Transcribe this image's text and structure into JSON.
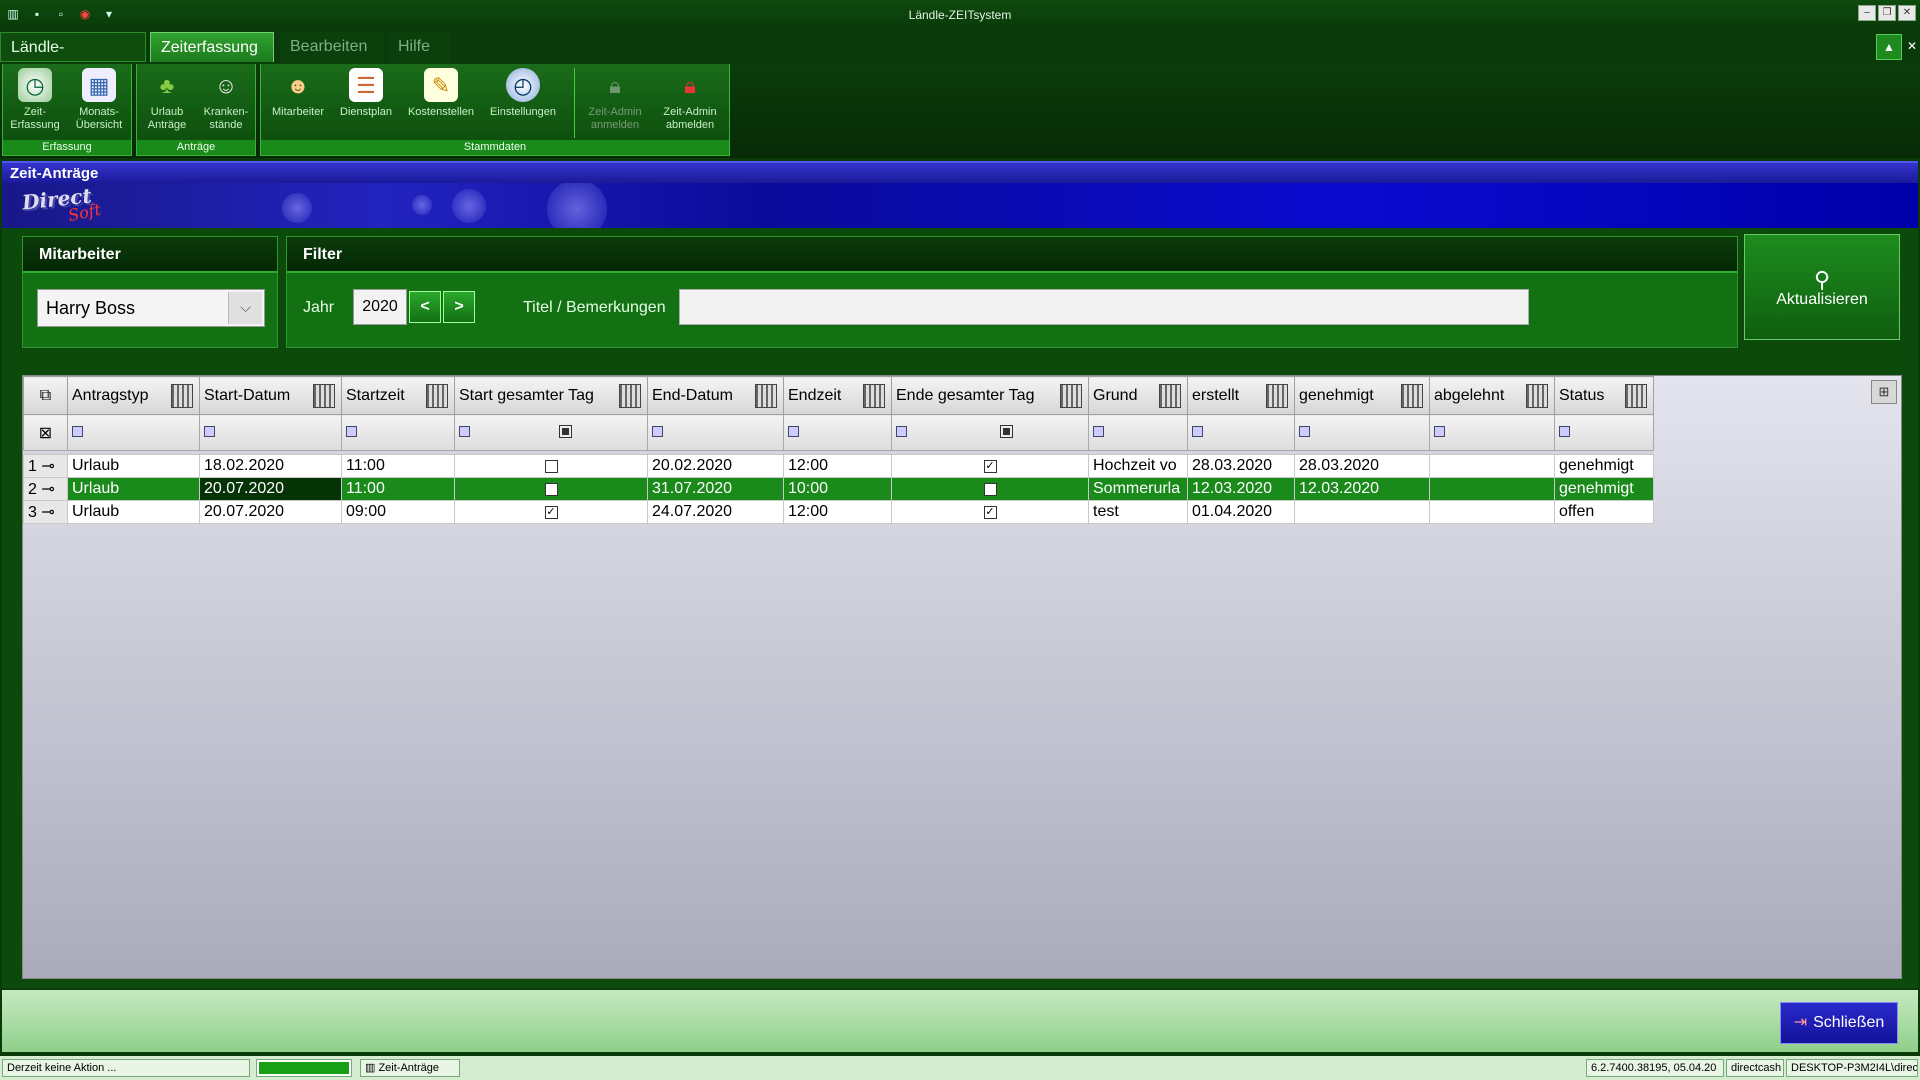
{
  "window": {
    "title": "Ländle-ZEITsystem"
  },
  "tabs": [
    {
      "label": "Ländle-ZEITsystem"
    },
    {
      "label": "Zeiterfassung"
    },
    {
      "label": "Bearbeiten"
    },
    {
      "label": "Hilfe"
    }
  ],
  "ribbon": {
    "groups": [
      {
        "label": "Erfassung",
        "items": [
          "Zeit-\nErfassung",
          "Monats-\nÜbersicht"
        ]
      },
      {
        "label": "Anträge",
        "items": [
          "Urlaub\nAnträge",
          "Kranken-\nstände"
        ]
      },
      {
        "label": "Stammdaten",
        "items": [
          "Mitarbeiter",
          "Dienstplan",
          "Kostenstellen",
          "Einstellungen",
          "Zeit-Admin\nanmelden",
          "Zeit-Admin\nabmelden"
        ]
      }
    ]
  },
  "form": {
    "title": "Zeit-Anträge",
    "logo_top": "Direct",
    "logo_bottom": "Soft"
  },
  "mitarbeiter": {
    "header": "Mitarbeiter",
    "selected": "Harry Boss"
  },
  "filter": {
    "header": "Filter",
    "jahr_label": "Jahr",
    "jahr_value": "2020",
    "prev": "<",
    "next": ">",
    "titel_label": "Titel / Bemerkungen",
    "titel_value": ""
  },
  "refresh": {
    "label": "Aktualisieren"
  },
  "grid": {
    "columns": [
      "Antragstyp",
      "Start-Datum",
      "Startzeit",
      "Start gesamter Tag",
      "End-Datum",
      "Endzeit",
      "Ende gesamter Tag",
      "Grund",
      "erstellt",
      "genehmigt",
      "abgelehnt",
      "Status"
    ],
    "rows": [
      {
        "nr": "1",
        "typ": "Urlaub",
        "start": "18.02.2020",
        "startzeit": "11:00",
        "start_ganz": false,
        "end": "20.02.2020",
        "endzeit": "12:00",
        "ende_ganz": true,
        "grund": "Hochzeit vo",
        "erstellt": "28.03.2020",
        "genehmigt": "28.03.2020",
        "abgelehnt": "",
        "status": "genehmigt"
      },
      {
        "nr": "2",
        "typ": "Urlaub",
        "start": "20.07.2020",
        "startzeit": "11:00",
        "start_ganz": false,
        "end": "31.07.2020",
        "endzeit": "10:00",
        "ende_ganz": false,
        "grund": "Sommerurla",
        "erstellt": "12.03.2020",
        "genehmigt": "12.03.2020",
        "abgelehnt": "",
        "status": "genehmigt"
      },
      {
        "nr": "3",
        "typ": "Urlaub",
        "start": "20.07.2020",
        "startzeit": "09:00",
        "start_ganz": true,
        "end": "24.07.2020",
        "endzeit": "12:00",
        "ende_ganz": true,
        "grund": "test",
        "erstellt": "01.04.2020",
        "genehmigt": "",
        "abgelehnt": "",
        "status": "offen"
      }
    ]
  },
  "close": {
    "label": "Schließen"
  },
  "status": {
    "message": "Derzeit keine Aktion ...",
    "progress": 1.0,
    "panel": "Zeit-Anträge",
    "version": "6.2.7400.38195, 05.04.20",
    "db": "directcash",
    "machine": "DESKTOP-P3M2I4L\\direc"
  },
  "colors": {
    "accent": "#1a8a1a",
    "dark": "#0a3a0a",
    "header_blue": "#2323c0"
  }
}
